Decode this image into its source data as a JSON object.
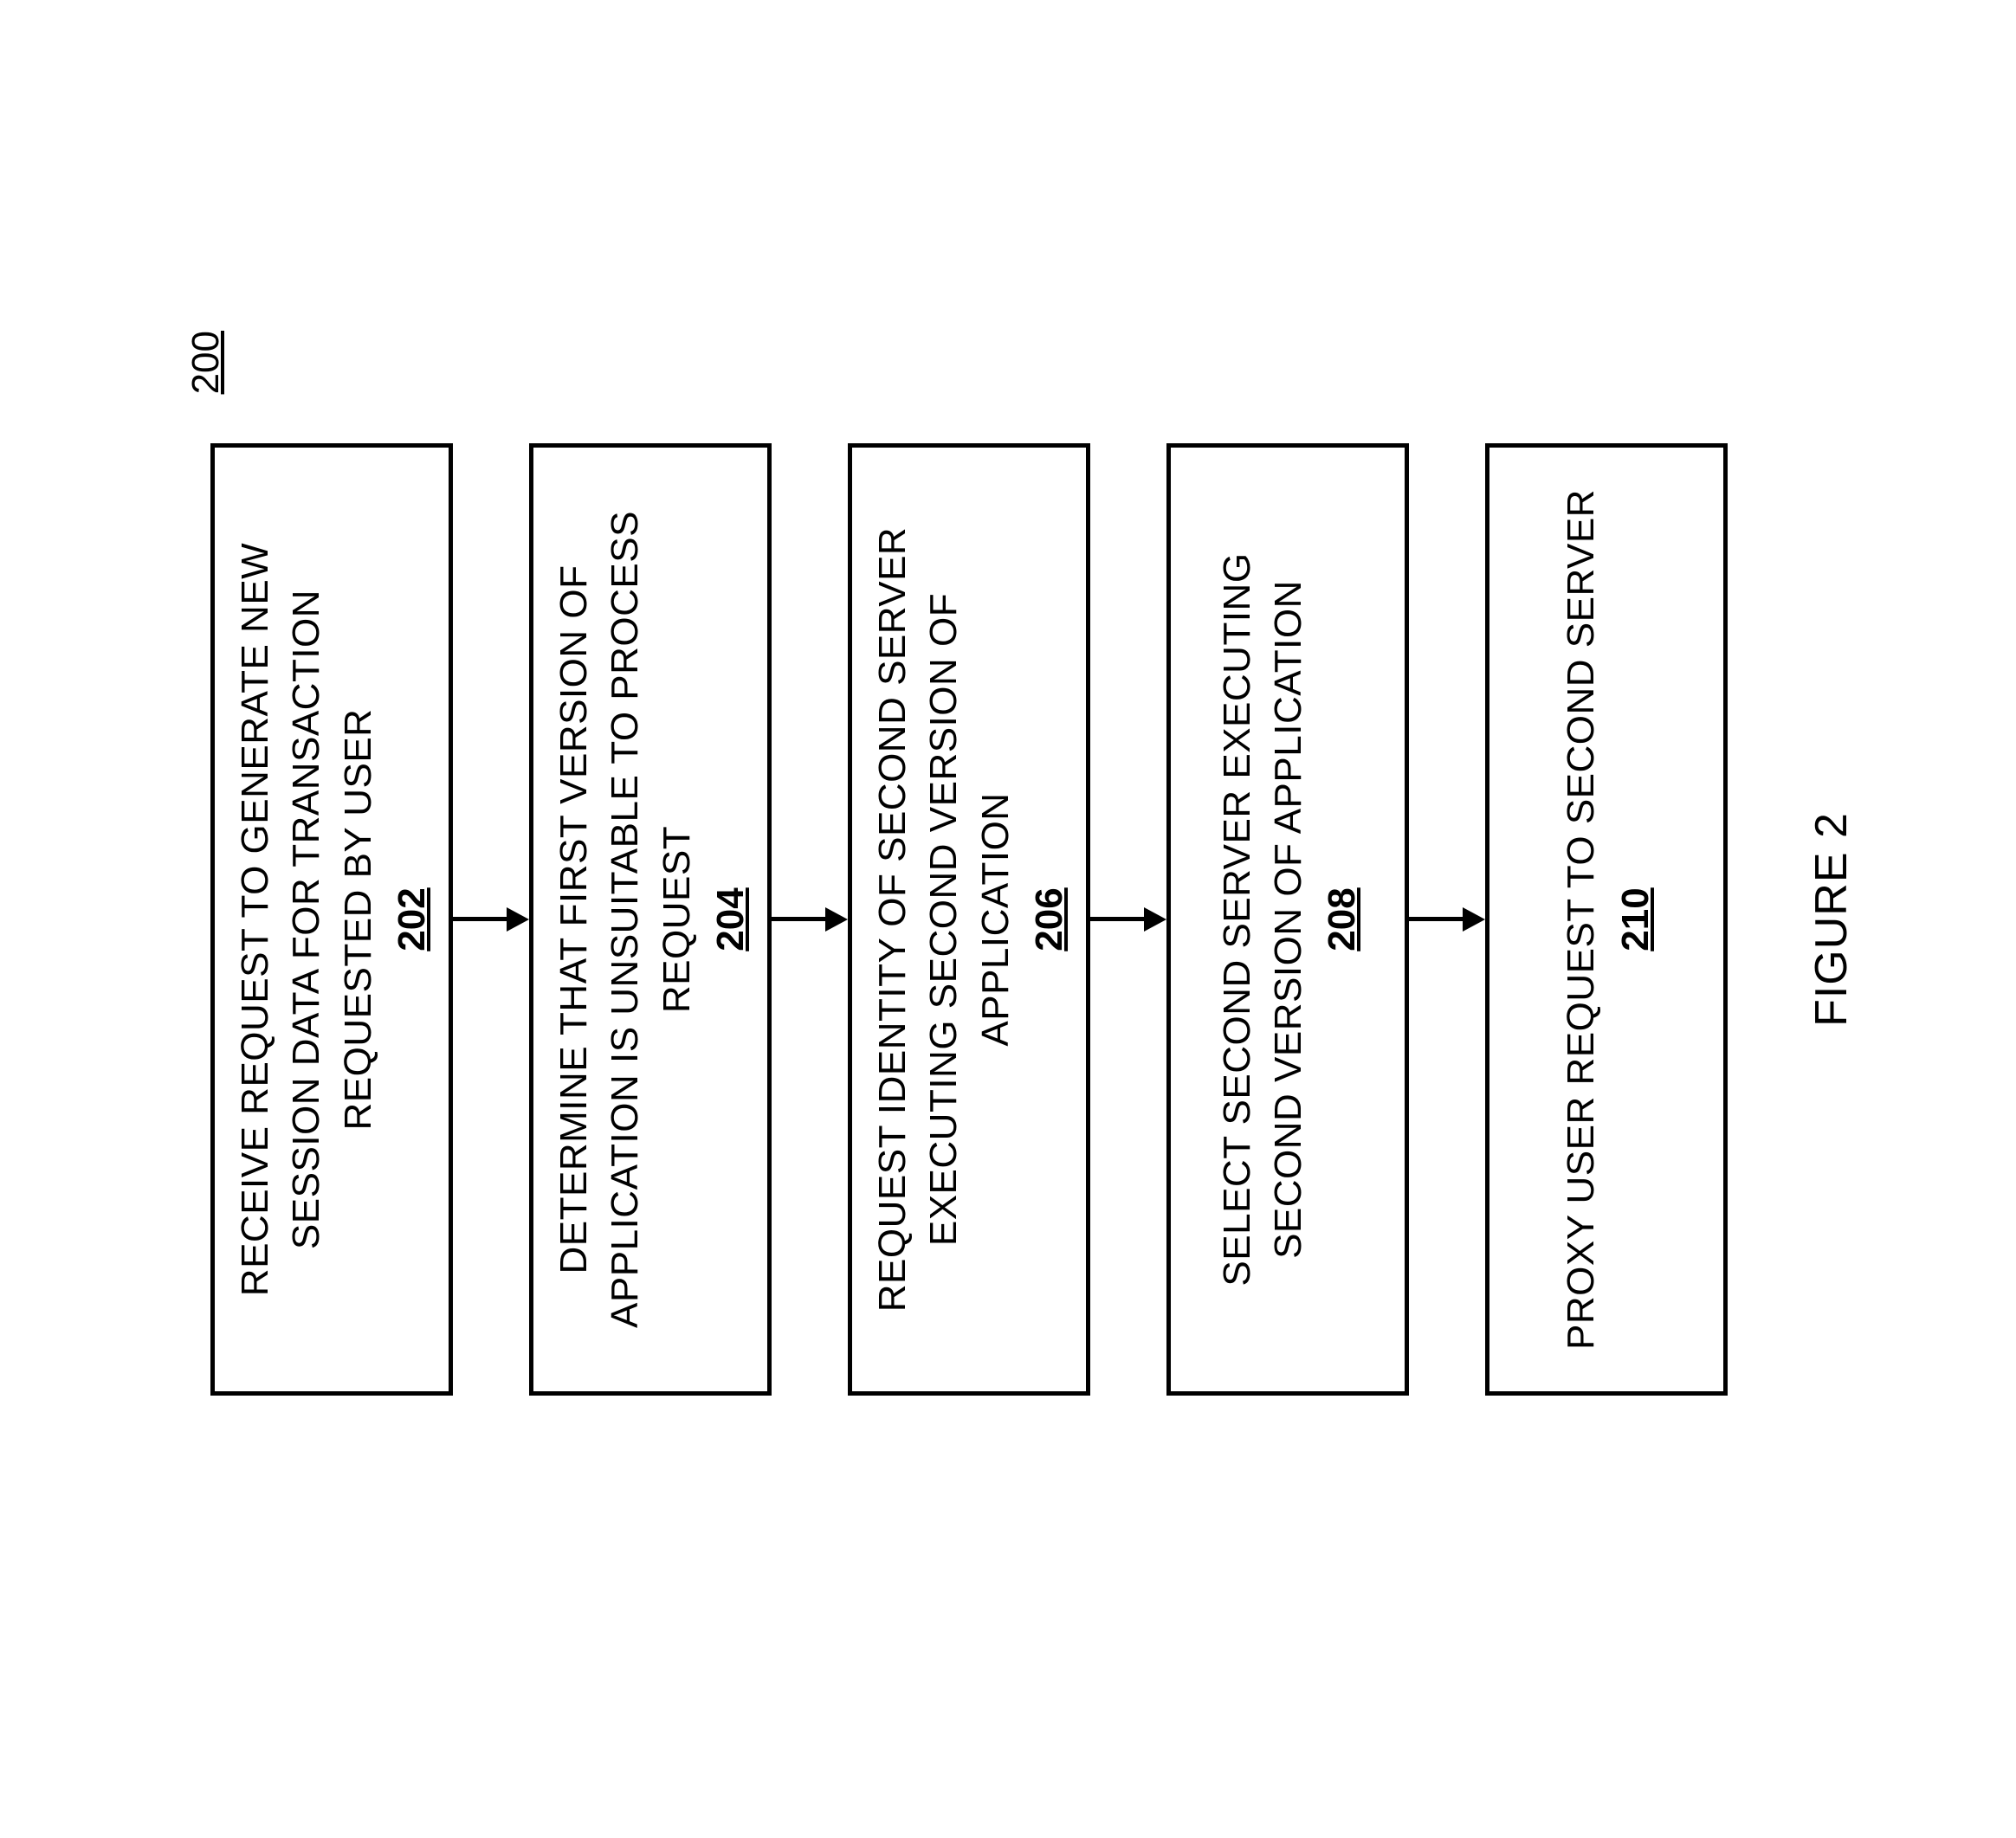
{
  "diagram_number": "200",
  "steps": [
    {
      "text": "RECEIVE REQUEST TO GENERATE NEW SESSION DATA FOR TRANSACTION REQUESTED BY USER",
      "ref": "202"
    },
    {
      "text": "DETERMINE THAT FIRST VERSION OF APPLICATION IS UNSUITABLE TO PROCESS REQUEST",
      "ref": "204"
    },
    {
      "text": "REQUEST IDENTITY OF SECOND SERVER EXECUTING SECOND VERSION OF APPLICATION",
      "ref": "206"
    },
    {
      "text": "SELECT SECOND SERVER EXECUTING SECOND VERSION OF APPLICATION",
      "ref": "208"
    },
    {
      "text": "PROXY USER REQUEST TO SECOND SERVER",
      "ref": "210"
    }
  ],
  "figure_label": "FIGURE 2"
}
